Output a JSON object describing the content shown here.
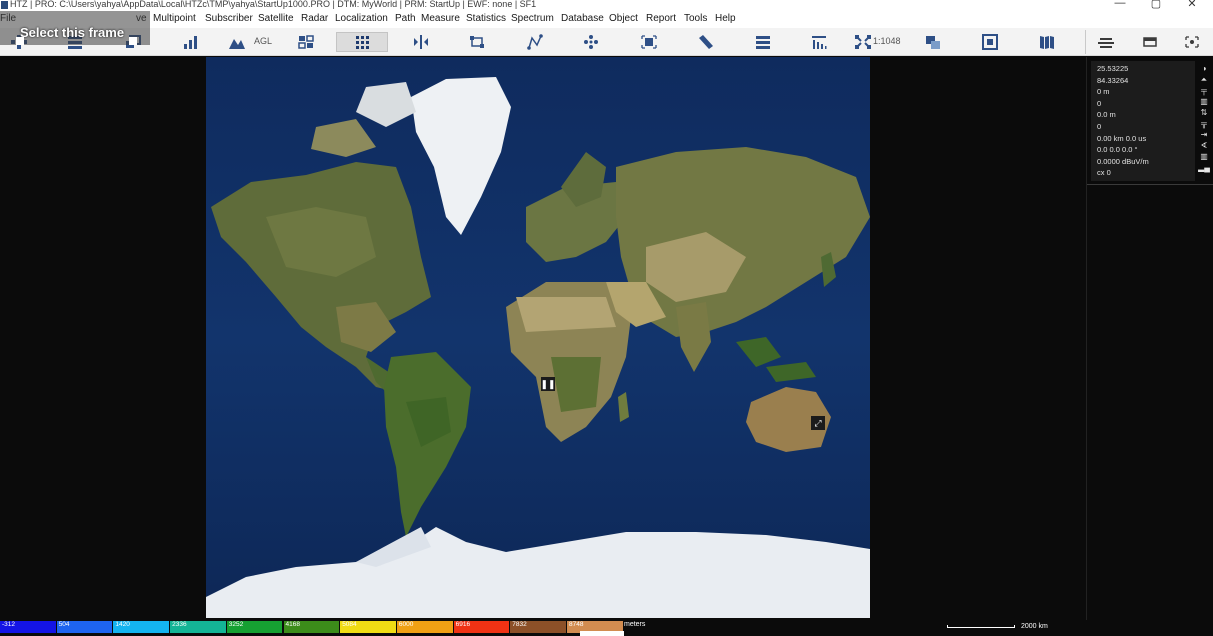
{
  "window": {
    "title": "HTZ | PRO: C:\\Users\\yahya\\AppData\\Local\\HTZc\\TMP\\yahya\\StartUp1000.PRO | DTM: MyWorld | PRM: StartUp | EWF: none | SF1",
    "minimize": "—",
    "maximize": "▢",
    "close": "✕"
  },
  "overlay": {
    "label": "Select this frame"
  },
  "menu": {
    "items": [
      "File",
      "ve",
      "Multipoint",
      "Subscriber",
      "Satellite",
      "Radar",
      "Localization",
      "Path",
      "Measure",
      "Statistics",
      "Spectrum",
      "Database",
      "Object",
      "Report",
      "Tools",
      "Help"
    ]
  },
  "toolbar": {
    "agl_label": "AGL",
    "scale_label": "1:1048"
  },
  "panel": {
    "lines": [
      "25.53225",
      "84.33264",
      "0 m",
      "0",
      "0.0 m",
      "0",
      "0.00 km 0.0 us",
      "0.0 0.0 0.0 °",
      "0.0000 dBuV/m",
      "cx 0"
    ]
  },
  "legend": {
    "swatches": [
      {
        "label": "-312",
        "color": "#1414e6"
      },
      {
        "label": "504",
        "color": "#1e64f0"
      },
      {
        "label": "1420",
        "color": "#14b4f0"
      },
      {
        "label": "2336",
        "color": "#14b496"
      },
      {
        "label": "3252",
        "color": "#16a032"
      },
      {
        "label": "4168",
        "color": "#3c8c1a"
      },
      {
        "label": "5084",
        "color": "#f0dc14"
      },
      {
        "label": "6000",
        "color": "#f0a014"
      },
      {
        "label": "6916",
        "color": "#f03214"
      },
      {
        "label": "7832",
        "color": "#8c5028"
      },
      {
        "label": "8748",
        "color": "#d28c50"
      }
    ],
    "unit": "meters"
  },
  "scale": {
    "label": "2000 km"
  }
}
